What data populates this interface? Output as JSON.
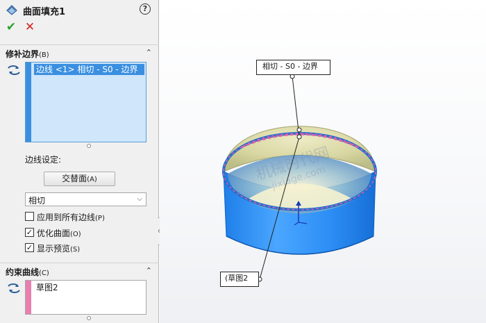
{
  "feature": {
    "icon": "surface-fill-icon",
    "title": "曲面填充1",
    "help_icon": "?"
  },
  "actions": {
    "ok_symbol": "✔",
    "cancel_symbol": "✕"
  },
  "patch_boundary": {
    "title": "修补边界",
    "shortcut": "(B)",
    "collapse_symbol": "⌃",
    "selection_icon": "selection-arrows-icon",
    "items": [
      "边线 <1> 相切 - S0 - 边界"
    ],
    "edge_settings_label": "边线设定:",
    "alternate_face_button": "交替面",
    "alternate_face_shortcut": "(A)",
    "condition_selected": "相切",
    "checkboxes": [
      {
        "label": "应用到所有边线",
        "shortcut": "(P)",
        "checked": false
      },
      {
        "label": "优化曲面",
        "shortcut": "(O)",
        "checked": true
      },
      {
        "label": "显示预览",
        "shortcut": "(S)",
        "checked": true
      }
    ]
  },
  "constraint_curves": {
    "title": "约束曲线",
    "shortcut": "(C)",
    "collapse_symbol": "⌃",
    "selection_icon": "selection-arrows-icon",
    "items": [
      "草图2"
    ]
  },
  "viewport": {
    "callout_top": "相切 - S0 - 边界",
    "callout_bottom": "(草图2",
    "watermark": "机械时代网",
    "watermark_sub": "jixiage.com",
    "colors": {
      "cylinder": "#2f8ff5",
      "dome": "#d8d7a0",
      "edge_highlight": "#e25fa8",
      "selection_blue": "#3a8fe0"
    }
  }
}
